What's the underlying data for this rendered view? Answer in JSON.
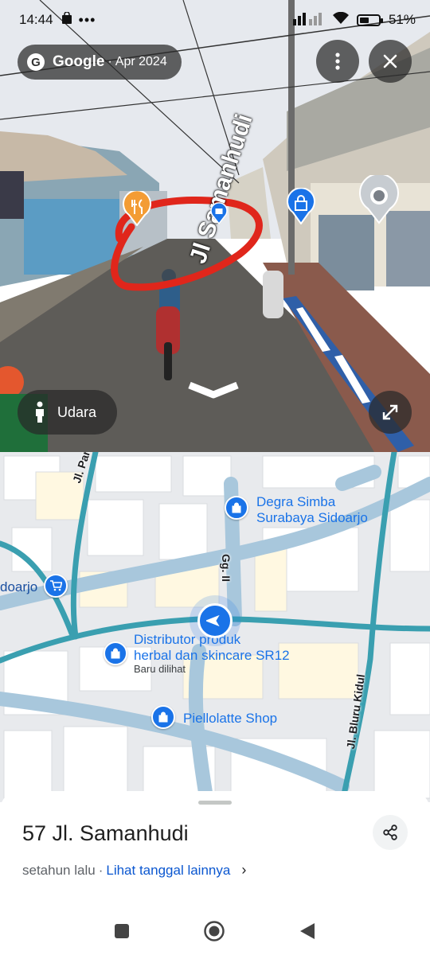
{
  "status_bar": {
    "time": "14:44",
    "battery": "51%",
    "battery_level": 0.51
  },
  "street_view": {
    "provider": "Google",
    "separator": "·",
    "capture_date": "Apr 2024",
    "road_label": "Jl Samanhudi",
    "mode_label": "Udara",
    "icons": [
      "more-vert-icon",
      "close-icon",
      "expand-icon",
      "person-icon",
      "chevron-down-icon",
      "restaurant-pin-icon",
      "shopping-pin-icon"
    ],
    "annotation_color": "#e0261b"
  },
  "map": {
    "pois": [
      {
        "name": "Degra Simba",
        "name2": "Surabaya Sidoarjo"
      },
      {
        "name": "Distributor produk",
        "name2": "herbal dan skincare SR12",
        "sub": "Baru dilihat"
      },
      {
        "name": "Piellolatte Shop"
      },
      {
        "name": "doarjo"
      }
    ],
    "streets": {
      "panjun": "Jl. Panjun",
      "gang": "Gg. II",
      "bluru": "Jl. Bluru Kidul"
    },
    "colors": {
      "road_main": "#3a9fb0",
      "road_minor": "#a8c7dc",
      "building": "#ffffff",
      "poi": "#1a73e8"
    }
  },
  "sheet": {
    "title": "57 Jl. Samanhudi",
    "ago": "setahun lalu",
    "dot": "·",
    "link": "Lihat tanggal lainnya",
    "chevron": "›"
  },
  "nav_bar": {
    "buttons": [
      "recents-square-icon",
      "home-circle-icon",
      "back-triangle-icon"
    ]
  }
}
